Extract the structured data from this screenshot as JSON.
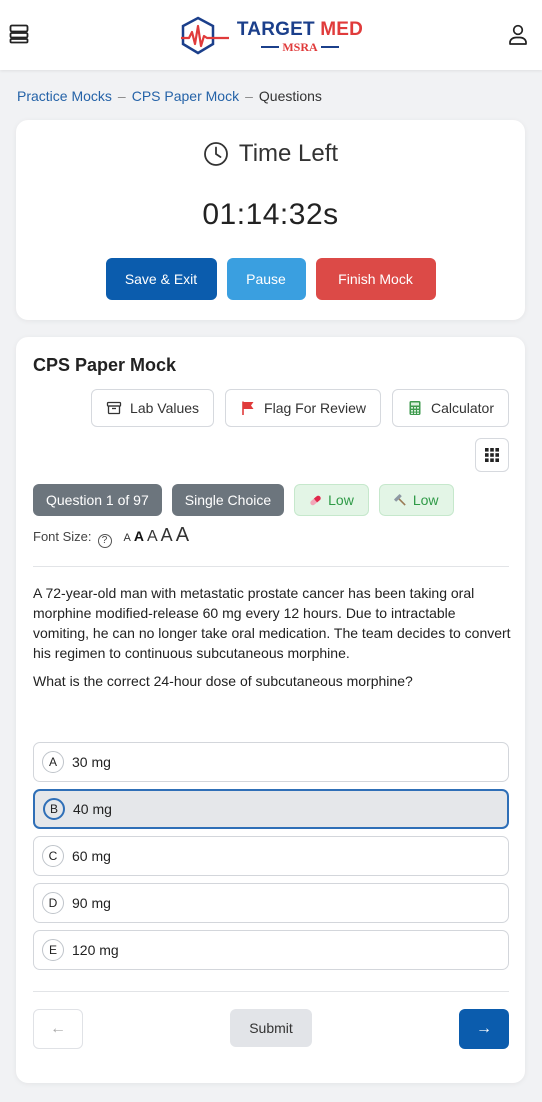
{
  "header": {
    "logo_main_1": "TARGET",
    "logo_main_2": "MED",
    "logo_sub": "MSRA"
  },
  "breadcrumb": {
    "items": [
      "Practice Mocks",
      "CPS Paper Mock",
      "Questions"
    ],
    "separator": "–"
  },
  "timer": {
    "label": "Time Left",
    "value": "01:14:32s",
    "save_label": "Save & Exit",
    "pause_label": "Pause",
    "finish_label": "Finish Mock"
  },
  "question_card": {
    "title": "CPS Paper Mock",
    "tools": {
      "lab_values": "Lab Values",
      "flag": "Flag For Review",
      "calculator": "Calculator"
    },
    "badges": {
      "question_count": "Question 1 of 97",
      "type": "Single Choice",
      "difficulty": "Low",
      "rating": "Low"
    },
    "font_size_label": "Font Size:",
    "font_size_options": [
      "A",
      "A",
      "A",
      "A",
      "A"
    ],
    "stem": "A 72-year-old man with metastatic prostate cancer has been taking oral morphine modified-release 60 mg every 12 hours. Due to intractable vomiting, he can no longer take oral medication. The team decides to convert his regimen to continuous subcutaneous morphine.",
    "question": "What is the correct 24-hour dose of subcutaneous morphine?",
    "options": [
      {
        "letter": "A",
        "text": "30 mg"
      },
      {
        "letter": "B",
        "text": "40 mg"
      },
      {
        "letter": "C",
        "text": "60 mg"
      },
      {
        "letter": "D",
        "text": "90 mg"
      },
      {
        "letter": "E",
        "text": "120 mg"
      }
    ],
    "selected_option": "B",
    "prev_label": "←",
    "submit_label": "Submit",
    "next_label": "→"
  },
  "colors": {
    "primary": "#0b5cad",
    "pause": "#3a9fe0",
    "finish": "#dc4a47",
    "selected_border": "#2f6fb7",
    "badge_grey": "#6c757d",
    "badge_green_text": "#2f9a47"
  },
  "icons": [
    "menu-icon",
    "logo-heartbeat-icon",
    "user-icon",
    "clock-icon",
    "archive-icon",
    "flag-icon",
    "calculator-icon",
    "grid-icon",
    "pill-icon",
    "hammer-icon",
    "help-icon",
    "arrow-left-icon",
    "arrow-right-icon"
  ]
}
